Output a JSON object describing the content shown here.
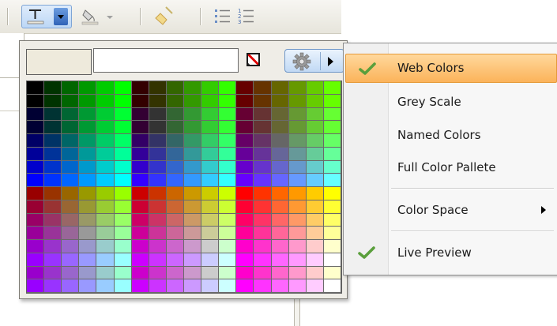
{
  "colors": {
    "current_swatch": "#eeeadc",
    "highlight_top": "#ffd89c",
    "highlight_bottom": "#fbb35a",
    "check_green": "#5a9f3c"
  },
  "toolbar": {
    "icons": [
      "text-color-icon",
      "fill-color-icon",
      "clear-format-icon",
      "bullet-list-icon",
      "numbered-list-icon"
    ]
  },
  "picker": {
    "hex_value": "",
    "rows": 16,
    "cols": 18,
    "palette": "web-safe"
  },
  "menu": {
    "items": [
      {
        "label": "Web Colors",
        "checked": true,
        "highlighted": true
      },
      {
        "label": "Grey Scale",
        "checked": false
      },
      {
        "label": "Named Colors",
        "checked": false
      },
      {
        "label": "Full Color Pallete",
        "checked": false
      },
      {
        "label": "Color Space",
        "checked": false,
        "submenu": true
      },
      {
        "label": "Live Preview",
        "checked": true
      }
    ]
  }
}
